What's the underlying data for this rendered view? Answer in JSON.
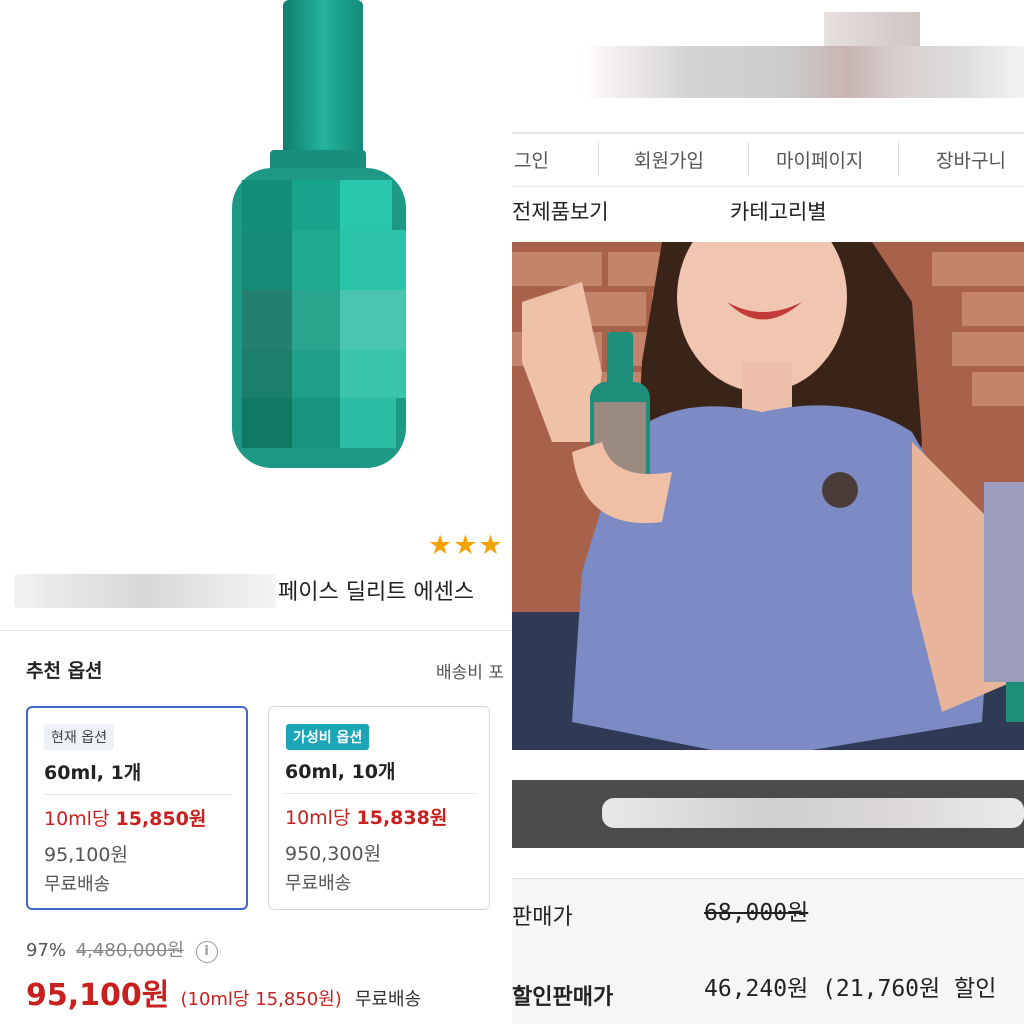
{
  "left": {
    "rating_stars": "★★★",
    "product_name": "페이스 딜리트 에센스",
    "recommended_title": "추천 옵션",
    "shipping_link": "배송비 포",
    "options": [
      {
        "badge": "현재 옵션",
        "name": "60ml, 1개",
        "unit_prefix": "10ml당",
        "unit_price": "15,850원",
        "price": "95,100원",
        "shipping": "무료배송"
      },
      {
        "badge": "가성비 옵션",
        "name": "60ml, 10개",
        "unit_prefix": "10ml당",
        "unit_price": "15,838원",
        "price": "950,300원",
        "shipping": "무료배송"
      }
    ],
    "discount_rate": "97%",
    "original_price": "4,480,000원",
    "info_icon_glyph": "i",
    "final_price": "95,100원",
    "final_unit": "(10ml당 15,850원)",
    "final_shipping": "무료배송",
    "colors": {
      "price_red": "#c8201e",
      "accent_blue": "#3f67c9",
      "badge_teal": "#1aa6b7",
      "star": "#f5a300",
      "bottle_green": "#1f9a87"
    }
  },
  "right": {
    "nav": [
      "그인",
      "회원가입",
      "마이페이지",
      "장바구니"
    ],
    "categories": [
      "전제품보기",
      "카테고리별"
    ],
    "price_rows": [
      {
        "label": "판매가",
        "value": "68,000원"
      },
      {
        "label": "할인판매가",
        "value": "46,240원 (21,760원 할인"
      }
    ]
  }
}
